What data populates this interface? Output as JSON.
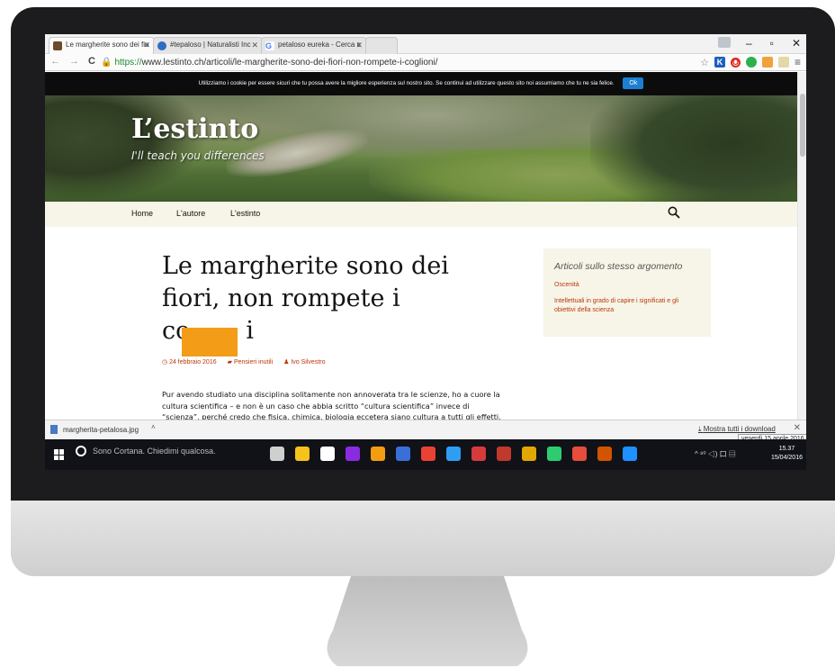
{
  "browser": {
    "tabs": [
      {
        "label": "Le margherite sono dei fio",
        "active": true,
        "favicon_color": "#6b4b2a"
      },
      {
        "label": "#tepaloso | Naturalisti Inc",
        "active": false,
        "favicon_color": "#2f6cc4"
      },
      {
        "label": "petaloso eureka - Cerca c",
        "active": false,
        "favicon_color": "#ffffff"
      }
    ],
    "window_controls": {
      "minimize": "–",
      "maximize": "▫",
      "close": "✕"
    },
    "nav": {
      "back": "←",
      "forward": "→",
      "reload": "C"
    },
    "address": {
      "scheme": "https://",
      "host_path": "www.lestinto.ch/articoli/le-margherite-sono-dei-fiori-non-rompete-i-coglioni/"
    },
    "star": "☆"
  },
  "page": {
    "cookie_banner": {
      "text": "Utilizziamo i cookie per essere sicuri che tu possa avere la migliore esperienza sul nostro sito. Se continui ad utilizzare questo sito noi assumiamo che tu ne sia felice.",
      "ok_label": "Ok"
    },
    "site_title": "L’estinto",
    "tagline": "I'll teach you differences",
    "nav": {
      "items": [
        "Home",
        "L'autore",
        "L'estinto"
      ],
      "search_icon": "⚲"
    },
    "post": {
      "title_line1": "Le margherite sono dei",
      "title_line2": "fiori, non rompete i",
      "title_line3_start": "co",
      "title_line3_end": "i",
      "date": "24 febbraio 2016",
      "category": "Pensieri inutili",
      "author": "Ivo Silvestro",
      "body": "Pur avendo studiato una disciplina solitamente non annoverata tra le scienze, ho a cuore la cultura scientifica – e non è un caso che abbia scritto “cultura scientifica” invece di “scienza”, perché credo che fisica, chimica, biologia eccetera siano cultura a tutti gli effetti."
    },
    "widget": {
      "title": "Articoli sullo stesso argomento",
      "links": [
        "Oscenità",
        "Intellettuali in grado di capire i significati e gli obiettivi della scienza"
      ]
    }
  },
  "download_bar": {
    "file_name": "margherita-petalosa.jpg",
    "caret": "˄",
    "show_all": "Mostra tutti i download",
    "close": "✕",
    "tooltip": "venerdì 15 aprile 2016"
  },
  "taskbar": {
    "search_placeholder": "Sono Cortana. Chiedimi qualcosa.",
    "time": "15.37",
    "date": "15/04/2016",
    "tray": "^ ⁸⁰ ◁) 口 ▤",
    "app_colors": [
      "#cfcfcf",
      "#f6c21c",
      "#ffffff",
      "#8a2be2",
      "#f39c12",
      "#3a6fd8",
      "#e94235",
      "#2f9df2",
      "#d63b3b",
      "#c0392b",
      "#e0a800",
      "#2ecc71",
      "#e74c3c",
      "#d35400",
      "#1e90ff"
    ]
  }
}
